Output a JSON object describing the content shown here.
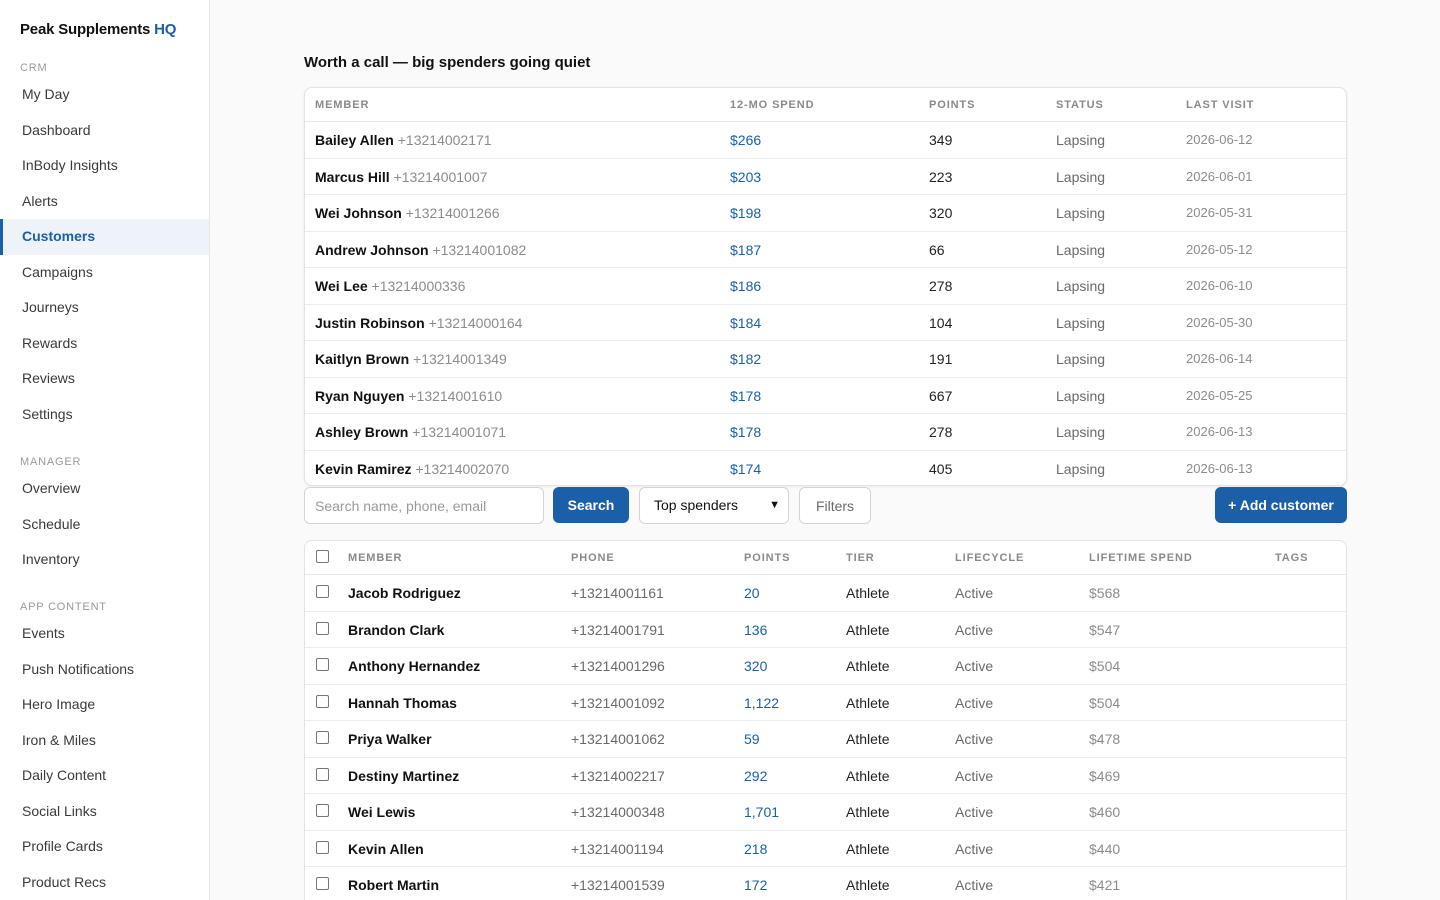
{
  "brand": {
    "name": "Peak Supplements",
    "suffix": "HQ"
  },
  "nav": {
    "crm_heading": "CRM",
    "crm": [
      "My Day",
      "Dashboard",
      "InBody Insights",
      "Alerts",
      "Customers",
      "Campaigns",
      "Journeys",
      "Rewards",
      "Reviews",
      "Settings"
    ],
    "manager_heading": "MANAGER",
    "manager": [
      "Overview",
      "Schedule",
      "Inventory"
    ],
    "app_heading": "APP CONTENT",
    "app": [
      "Events",
      "Push Notifications",
      "Hero Image",
      "Iron & Miles",
      "Daily Content",
      "Social Links",
      "Profile Cards",
      "Product Recs"
    ],
    "active": "Customers"
  },
  "lapsing": {
    "title": "Worth a call — big spenders going quiet",
    "headers": [
      "MEMBER",
      "12-MO SPEND",
      "POINTS",
      "STATUS",
      "LAST VISIT"
    ],
    "rows": [
      {
        "name": "Bailey Allen",
        "phone": "+13214002171",
        "spend": "$266",
        "points": "349",
        "status": "Lapsing",
        "last_visit": "2026-06-12"
      },
      {
        "name": "Marcus Hill",
        "phone": "+13214001007",
        "spend": "$203",
        "points": "223",
        "status": "Lapsing",
        "last_visit": "2026-06-01"
      },
      {
        "name": "Wei Johnson",
        "phone": "+13214001266",
        "spend": "$198",
        "points": "320",
        "status": "Lapsing",
        "last_visit": "2026-05-31"
      },
      {
        "name": "Andrew Johnson",
        "phone": "+13214001082",
        "spend": "$187",
        "points": "66",
        "status": "Lapsing",
        "last_visit": "2026-05-12"
      },
      {
        "name": "Wei Lee",
        "phone": "+13214000336",
        "spend": "$186",
        "points": "278",
        "status": "Lapsing",
        "last_visit": "2026-06-10"
      },
      {
        "name": "Justin Robinson",
        "phone": "+13214000164",
        "spend": "$184",
        "points": "104",
        "status": "Lapsing",
        "last_visit": "2026-05-30"
      },
      {
        "name": "Kaitlyn Brown",
        "phone": "+13214001349",
        "spend": "$182",
        "points": "191",
        "status": "Lapsing",
        "last_visit": "2026-06-14"
      },
      {
        "name": "Ryan Nguyen",
        "phone": "+13214001610",
        "spend": "$178",
        "points": "667",
        "status": "Lapsing",
        "last_visit": "2026-05-25"
      },
      {
        "name": "Ashley Brown",
        "phone": "+13214001071",
        "spend": "$178",
        "points": "278",
        "status": "Lapsing",
        "last_visit": "2026-06-13"
      },
      {
        "name": "Kevin Ramirez",
        "phone": "+13214002070",
        "spend": "$174",
        "points": "405",
        "status": "Lapsing",
        "last_visit": "2026-06-13"
      }
    ]
  },
  "toolbar": {
    "search_placeholder": "Search name, phone, email",
    "search_button": "Search",
    "sort_selected": "Top spenders",
    "filters_button": "Filters",
    "add_button": "+ Add customer"
  },
  "customers": {
    "headers": [
      "MEMBER",
      "PHONE",
      "POINTS",
      "TIER",
      "LIFECYCLE",
      "LIFETIME SPEND",
      "TAGS"
    ],
    "rows": [
      {
        "name": "Jacob Rodriguez",
        "phone": "+13214001161",
        "points": "20",
        "tier": "Athlete",
        "lifecycle": "Active",
        "spend": "$568"
      },
      {
        "name": "Brandon Clark",
        "phone": "+13214001791",
        "points": "136",
        "tier": "Athlete",
        "lifecycle": "Active",
        "spend": "$547"
      },
      {
        "name": "Anthony Hernandez",
        "phone": "+13214001296",
        "points": "320",
        "tier": "Athlete",
        "lifecycle": "Active",
        "spend": "$504"
      },
      {
        "name": "Hannah Thomas",
        "phone": "+13214001092",
        "points": "1,122",
        "tier": "Athlete",
        "lifecycle": "Active",
        "spend": "$504"
      },
      {
        "name": "Priya Walker",
        "phone": "+13214001062",
        "points": "59",
        "tier": "Athlete",
        "lifecycle": "Active",
        "spend": "$478"
      },
      {
        "name": "Destiny Martinez",
        "phone": "+13214002217",
        "points": "292",
        "tier": "Athlete",
        "lifecycle": "Active",
        "spend": "$469"
      },
      {
        "name": "Wei Lewis",
        "phone": "+13214000348",
        "points": "1,701",
        "tier": "Athlete",
        "lifecycle": "Active",
        "spend": "$460"
      },
      {
        "name": "Kevin Allen",
        "phone": "+13214001194",
        "points": "218",
        "tier": "Athlete",
        "lifecycle": "Active",
        "spend": "$440"
      },
      {
        "name": "Robert Martin",
        "phone": "+13214001539",
        "points": "172",
        "tier": "Athlete",
        "lifecycle": "Active",
        "spend": "$421"
      }
    ]
  }
}
